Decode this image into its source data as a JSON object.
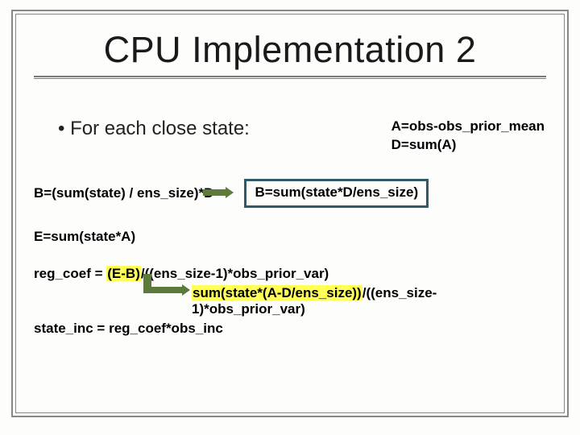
{
  "title": "CPU Implementation 2",
  "bullet": "•  For each close state:",
  "side": {
    "l1": "A=obs-obs_prior_mean",
    "l2": "D=sum(A)"
  },
  "b_left": "B=(sum(state) / ens_size)*D",
  "b_box": "B=sum(state*D/ens_size)",
  "e_line": "E=sum(state*A)",
  "reg": {
    "pre": "reg_coef = ",
    "hl": "(E-B)",
    "post": "/((ens_size-1)*obs_prior_var)"
  },
  "sum": {
    "hl": "sum(state*(A-D/ens_size))",
    "post": "/((ens_size-1)*obs_prior_var)"
  },
  "stateinc": "state_inc = reg_coef*obs_inc"
}
